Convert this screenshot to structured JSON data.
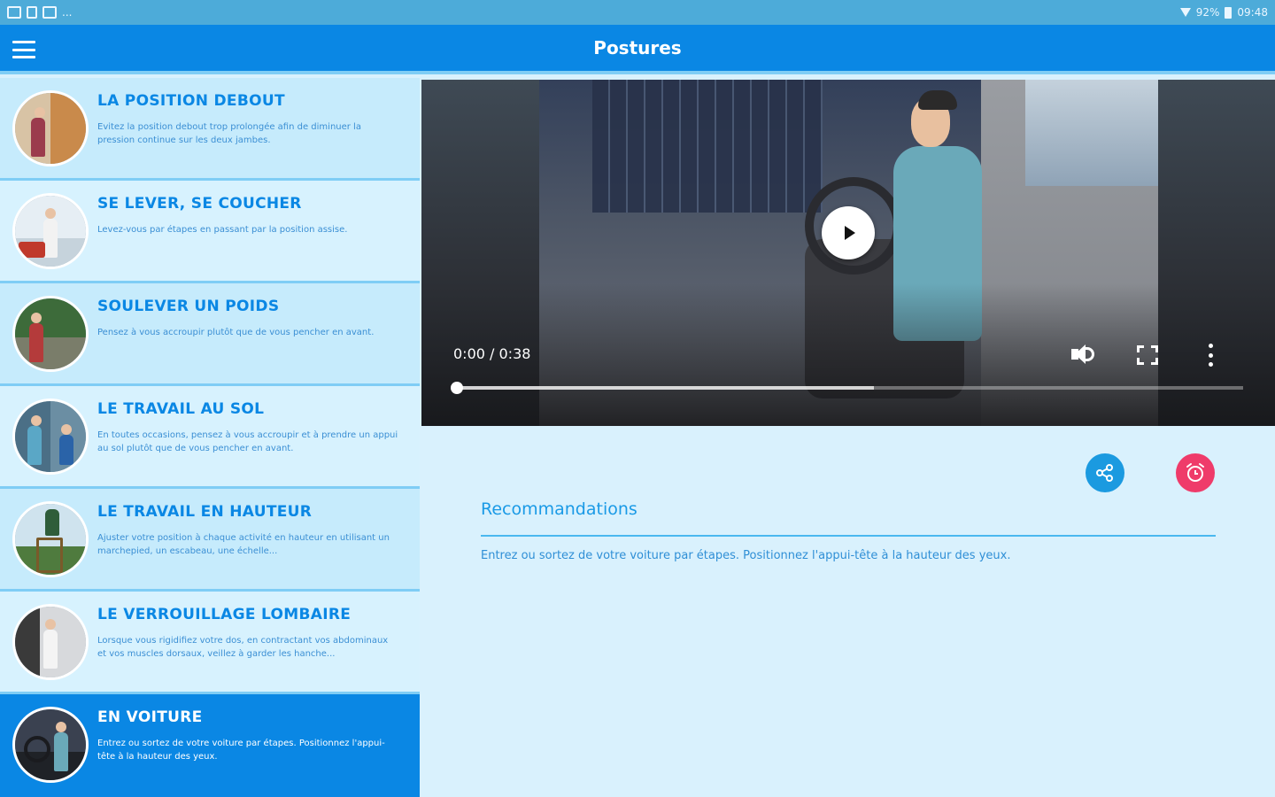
{
  "statusbar": {
    "battery": "92%",
    "time": "09:48",
    "overflow": "..."
  },
  "appbar": {
    "title": "Postures"
  },
  "list": {
    "items": [
      {
        "title": "LA POSITION DEBOUT",
        "desc": "Evitez la position debout trop prolongée afin de diminuer la pression continue sur les deux jambes."
      },
      {
        "title": "SE LEVER, SE COUCHER",
        "desc": "Levez-vous par étapes en passant par la position assise."
      },
      {
        "title": "SOULEVER UN POIDS",
        "desc": "Pensez à vous accroupir plutôt que de vous pencher en avant."
      },
      {
        "title": "LE TRAVAIL AU SOL",
        "desc": "En toutes occasions, pensez à vous accroupir et à prendre un appui au sol plutôt que de vous pencher en avant."
      },
      {
        "title": "LE TRAVAIL EN HAUTEUR",
        "desc": "Ajuster votre position à chaque activité en hauteur en utilisant un marchepied, un escabeau, une échelle..."
      },
      {
        "title": "LE VERROUILLAGE LOMBAIRE",
        "desc": "Lorsque vous rigidifiez votre dos, en contractant vos abdominaux et vos muscles dorsaux, veillez à garder les hanche..."
      },
      {
        "title": "EN VOITURE",
        "desc": "Entrez ou sortez de votre voiture par étapes. Positionnez l'appui-tête à la hauteur des yeux."
      }
    ]
  },
  "video": {
    "time": "0:00 / 0:38",
    "progress": 0.0,
    "buffered": 0.53
  },
  "recommendations": {
    "title": "Recommandations",
    "text": "Entrez ou sortez de votre voiture par étapes. Positionnez l'appui-tête à la hauteur des yeux."
  },
  "colors": {
    "primary": "#0a87e4",
    "share": "#1b9ae0",
    "alarm": "#ef3b6a"
  },
  "icons": {
    "menu": "menu-icon",
    "play": "play-icon",
    "volume": "volume-icon",
    "fullscreen": "fullscreen-icon",
    "more": "more-vert-icon",
    "share": "share-icon",
    "alarm": "alarm-icon"
  }
}
